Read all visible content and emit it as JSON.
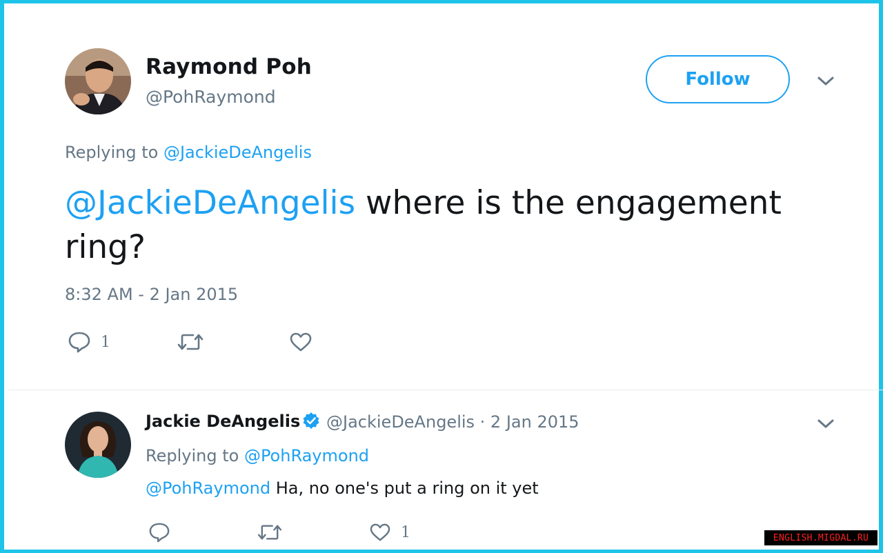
{
  "main_tweet": {
    "author_name": "Raymond Poh",
    "author_handle": "@PohRaymond",
    "follow_label": "Follow",
    "replying_prefix": "Replying to ",
    "replying_to": "@JackieDeAngelis",
    "text_mention": "@JackieDeAngelis",
    "text_body": " where is the engagement ring?",
    "timestamp": "8:32 AM - 2 Jan 2015",
    "reply_count": "1",
    "retweet_count": "",
    "like_count": ""
  },
  "reply_tweet": {
    "author_name": "Jackie DeAngelis",
    "author_handle": "@JackieDeAngelis",
    "date_separator": " · ",
    "date": "2 Jan 2015",
    "replying_prefix": "Replying to ",
    "replying_to": "@PohRaymond",
    "text_mention": "@PohRaymond",
    "text_body": " Ha, no one's put a ring on it yet",
    "reply_count": "",
    "retweet_count": "",
    "like_count": "1"
  },
  "watermark": "ENGLISH.MIGDAL.RU",
  "colors": {
    "accent": "#1da1f2",
    "frame": "#1ec3e8",
    "muted": "#657786",
    "text": "#14171a"
  },
  "icons": {
    "reply": "reply-icon",
    "retweet": "retweet-icon",
    "like": "heart-icon",
    "more": "chevron-down-icon",
    "verified": "verified-badge-icon"
  }
}
